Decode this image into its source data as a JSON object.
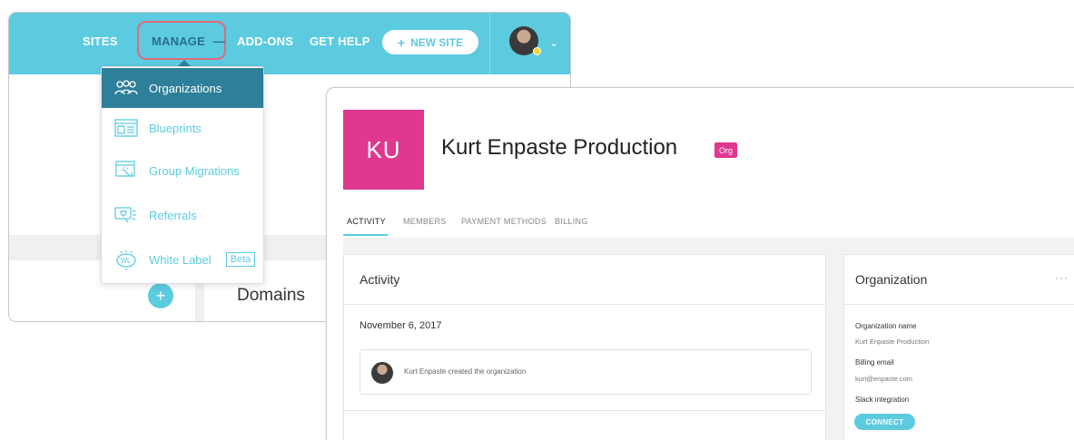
{
  "topnav": {
    "sites": "SITES",
    "manage": "MANAGE",
    "manage_dash": "—",
    "addons": "ADD-ONS",
    "get_help": "GET HELP",
    "new_site_plus": "+",
    "new_site": "NEW SITE",
    "chevron": "⌄"
  },
  "dropdown": {
    "items": [
      {
        "label": "Organizations",
        "icon": "organizations-icon"
      },
      {
        "label": "Blueprints",
        "icon": "blueprints-icon"
      },
      {
        "label": "Group Migrations",
        "icon": "group-migrations-icon"
      },
      {
        "label": "Referrals",
        "icon": "referrals-icon"
      },
      {
        "label": "White Label",
        "icon": "white-label-icon",
        "badge": "Beta"
      }
    ]
  },
  "back_panel": {
    "plus": "+",
    "domains_title": "Domains"
  },
  "org": {
    "initials": "KU",
    "name": "Kurt Enpaste Production",
    "badge": "Org",
    "tabs": [
      "ACTIVITY",
      "MEMBERS",
      "PAYMENT METHODS",
      "BILLING"
    ],
    "activity": {
      "title": "Activity",
      "date": "November 6, 2017",
      "event": "Kurt Enpaste created the organization"
    },
    "details": {
      "title": "Organization",
      "more": "···",
      "org_name_label": "Organization name",
      "org_name_value": "Kurt Enpaste Production",
      "billing_email_label": "Billing email",
      "billing_email_value": "kurt@enpaste.com",
      "slack_label": "Slack integration",
      "connect": "CONNECT"
    }
  },
  "colors": {
    "brand_cyan": "#5ccbe0",
    "active_teal": "#2e7f9a",
    "org_pink": "#e0378f",
    "highlight_red": "#e06a78"
  }
}
